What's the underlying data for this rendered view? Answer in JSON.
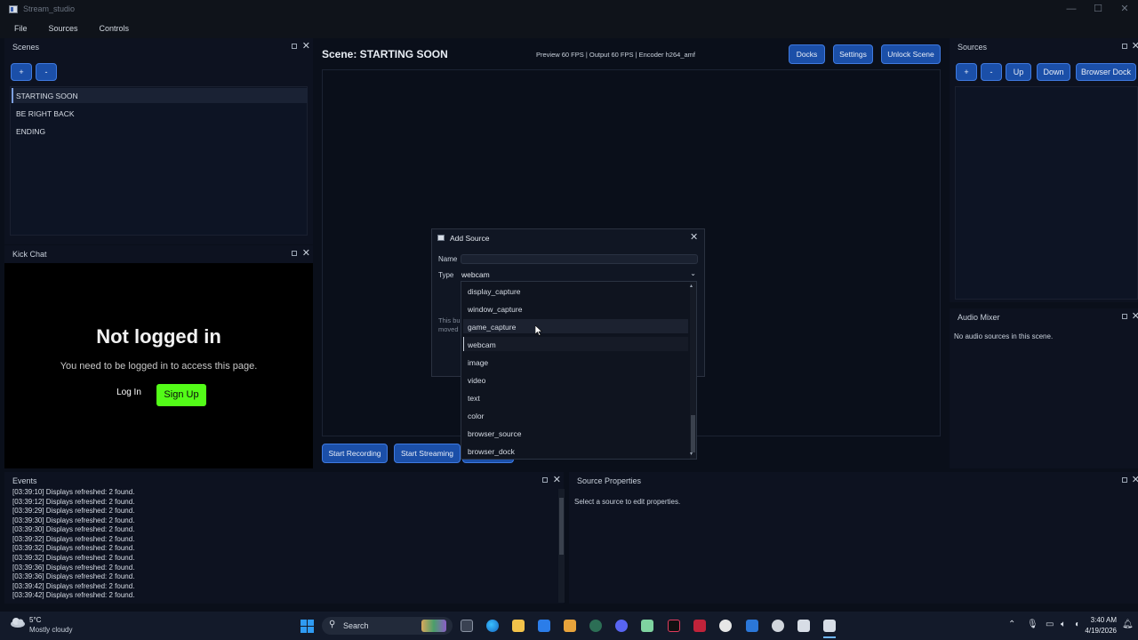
{
  "window": {
    "title": "Stream_studio",
    "controls": [
      "—",
      "☐",
      "✕"
    ]
  },
  "menu": [
    "File",
    "Sources",
    "Controls"
  ],
  "scenes": {
    "title": "Scenes",
    "add": "+",
    "remove": "-",
    "items": [
      "STARTING SOON",
      "BE RIGHT BACK",
      "ENDING"
    ]
  },
  "kick_chat": {
    "title": "Kick Chat",
    "heading": "Not logged in",
    "message": "You need to be logged in to access this page.",
    "login": "Log In",
    "signup": "Sign Up"
  },
  "preview": {
    "scene_label": "Scene: STARTING SOON",
    "stats": "Preview 60 FPS | Output 60 FPS | Encoder h264_amf",
    "docks": "Docks",
    "settings": "Settings",
    "unlock": "Unlock Scene",
    "start_recording": "Start Recording",
    "start_streaming": "Start Streaming"
  },
  "sources": {
    "title": "Sources",
    "add": "+",
    "remove": "-",
    "up": "Up",
    "down": "Down",
    "browser_dock": "Browser Dock"
  },
  "audio_mixer": {
    "title": "Audio Mixer",
    "empty": "No audio sources in this scene."
  },
  "dialog": {
    "title": "Add Source",
    "name_label": "Name",
    "name_value": "",
    "type_label": "Type",
    "type_value": "webcam",
    "hint_line1": "This bu",
    "hint_line2": "moved",
    "options": [
      "display_capture",
      "window_capture",
      "game_capture",
      "webcam",
      "image",
      "video",
      "text",
      "color",
      "browser_source",
      "browser_dock"
    ],
    "hovered_option": "game_capture",
    "selected_option": "webcam"
  },
  "events": {
    "title": "Events",
    "lines": [
      "[03:39:10] Displays refreshed: 2 found.",
      "[03:39:12] Displays refreshed: 2 found.",
      "[03:39:29] Displays refreshed: 2 found.",
      "[03:39:30] Displays refreshed: 2 found.",
      "[03:39:30] Displays refreshed: 2 found.",
      "[03:39:32] Displays refreshed: 2 found.",
      "[03:39:32] Displays refreshed: 2 found.",
      "[03:39:32] Displays refreshed: 2 found.",
      "[03:39:36] Displays refreshed: 2 found.",
      "[03:39:36] Displays refreshed: 2 found.",
      "[03:39:42] Displays refreshed: 2 found.",
      "[03:39:42] Displays refreshed: 2 found."
    ]
  },
  "source_properties": {
    "title": "Source Properties",
    "empty": "Select a source to edit properties."
  },
  "taskbar": {
    "weather_temp": "5°C",
    "weather_desc": "Mostly cloudy",
    "search": "Search",
    "time": "3:40 AM",
    "date": "4/19/2026"
  },
  "colors": {
    "accent": "#1b4fa8",
    "signup": "#53fc18",
    "background": "#0a0f1a"
  }
}
